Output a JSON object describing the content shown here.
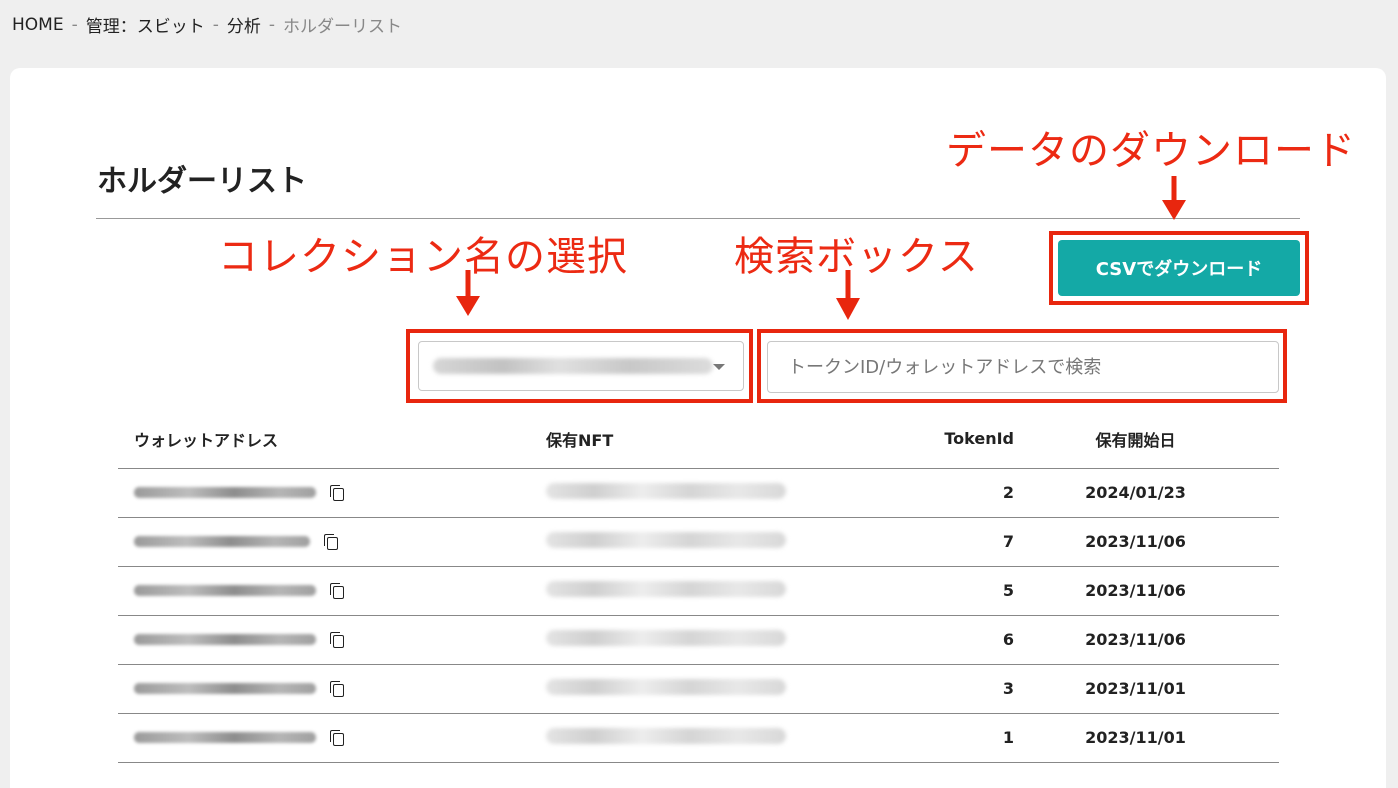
{
  "breadcrumb": {
    "home": "HOME",
    "admin": "管理：スビット",
    "analysis": "分析",
    "current": "ホルダーリスト",
    "separator": "-"
  },
  "page": {
    "title": "ホルダーリスト"
  },
  "annotations": {
    "download": "データのダウンロード",
    "collection": "コレクション名の選択",
    "search": "検索ボックス"
  },
  "toolbar": {
    "csv_button": "CSVでダウンロード"
  },
  "filters": {
    "collection_select_value": "",
    "search_placeholder": "トークンID/ウォレットアドレスで検索"
  },
  "table": {
    "headers": {
      "wallet": "ウォレットアドレス",
      "nft": "保有NFT",
      "token": "TokenId",
      "date": "保有開始日"
    },
    "rows": [
      {
        "token_id": "2",
        "start_date": "2024/01/23"
      },
      {
        "token_id": "7",
        "start_date": "2023/11/06"
      },
      {
        "token_id": "5",
        "start_date": "2023/11/06"
      },
      {
        "token_id": "6",
        "start_date": "2023/11/06"
      },
      {
        "token_id": "3",
        "start_date": "2023/11/01"
      },
      {
        "token_id": "1",
        "start_date": "2023/11/01"
      }
    ]
  },
  "colors": {
    "accent": "#14a9a6",
    "annotation": "#ec2a13",
    "background": "#efefef"
  },
  "icons": {
    "copy": "copy-icon",
    "dropdown": "chevron-down-icon",
    "arrow": "arrow-down-icon"
  }
}
